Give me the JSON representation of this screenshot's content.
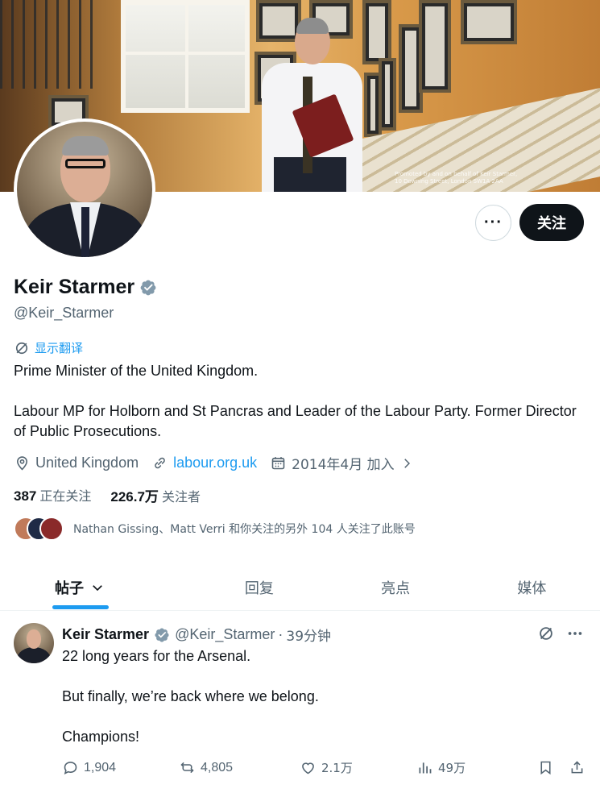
{
  "banner": {
    "promo_line1": "Promoted by and on behalf of Keir Starmer,",
    "promo_line2": "10 Downing Street, London SW1A 2AA"
  },
  "profile": {
    "name": "Keir Starmer",
    "handle": "@Keir_Starmer",
    "follow_label": "关注",
    "more_label": "···",
    "translate_label": "显示翻译",
    "bio_line1": "Prime Minister of the United Kingdom.",
    "bio_line2": "Labour MP for Holborn and St Pancras and Leader of the Labour Party. Former Director of Public Prosecutions.",
    "location": "United Kingdom",
    "website": "labour.org.uk",
    "joined": "2014年4月 加入",
    "following_count": "387",
    "following_label": "正在关注",
    "followers_count": "226.7万",
    "followers_label": "关注者",
    "followed_by_text": "Nathan Gissing、Matt Verri 和你关注的另外 104 人关注了此账号"
  },
  "tabs": [
    {
      "label": "帖子"
    },
    {
      "label": "回复"
    },
    {
      "label": "亮点"
    },
    {
      "label": "媒体"
    }
  ],
  "tweet": {
    "author_name": "Keir Starmer",
    "author_handle": "@Keir_Starmer",
    "separator": "·",
    "time": "39分钟",
    "line1": "22 long years for the Arsenal.",
    "line2": "But finally, we’re back where we belong.",
    "line3": "Champions!",
    "replies": "1,904",
    "reposts": "4,805",
    "likes": "2.1万",
    "views": "49万"
  },
  "colors": {
    "accent": "#1d9bf0",
    "text": "#0f1419",
    "secondary": "#536471",
    "verified": "#829aab"
  }
}
